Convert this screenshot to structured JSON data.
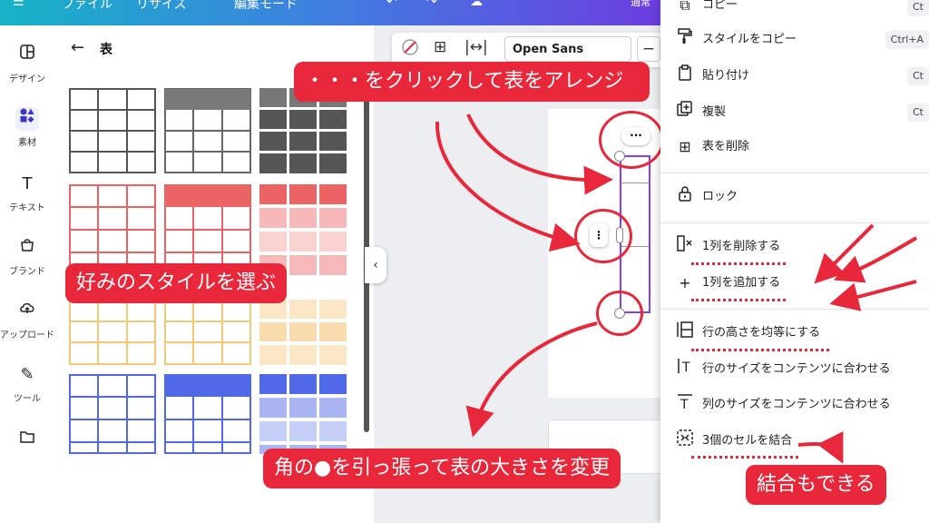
{
  "topbar": {
    "file_label": "ファイル",
    "resize_label": "リサイズ",
    "edit_label": "編集モード",
    "right_label": "通常"
  },
  "sidebar": {
    "items": [
      {
        "label": "デザイン",
        "icon": "layout-icon"
      },
      {
        "label": "素材",
        "icon": "elements-icon"
      },
      {
        "label": "テキスト",
        "icon": "text-icon"
      },
      {
        "label": "ブランド",
        "icon": "brand-icon"
      },
      {
        "label": "アップロード",
        "icon": "upload-icon"
      },
      {
        "label": "ツール",
        "icon": "tools-icon"
      },
      {
        "label": "",
        "icon": "folder-icon"
      }
    ]
  },
  "panel": {
    "title": "表",
    "styles": [
      {
        "name": "gray",
        "header": "#7a7a7a",
        "border": "#555555",
        "fill": "#ffffff",
        "alt": "#555555"
      },
      {
        "name": "red",
        "header": "#ec6363",
        "border": "#ec6363",
        "fill": "#fbd2d2",
        "alt": "#f6b8b8"
      },
      {
        "name": "orange",
        "header": "#f5c776",
        "border": "#f5c776",
        "fill": "#fbe7c6",
        "alt": "#f8dcae"
      },
      {
        "name": "blue",
        "header": "#4f69e8",
        "border": "#4f69e8",
        "fill": "#c6cff8",
        "alt": "#aab6f3"
      }
    ]
  },
  "toolbar": {
    "font_name": "Open Sans"
  },
  "context_menu": {
    "items": [
      {
        "label": "コピー",
        "icon": "copy-icon",
        "shortcut": "Ct"
      },
      {
        "label": "スタイルをコピー",
        "icon": "paint-roller-icon",
        "shortcut": "Ctrl+A"
      },
      {
        "label": "貼り付け",
        "icon": "paste-icon",
        "shortcut": "Ct"
      },
      {
        "label": "複製",
        "icon": "duplicate-icon",
        "shortcut": "Ct"
      },
      {
        "label": "表を削除",
        "icon": "table-delete-icon",
        "shortcut": ""
      },
      {
        "label": "ロック",
        "icon": "lock-icon",
        "shortcut": ""
      },
      {
        "label": "1列を削除する",
        "icon": "column-delete-icon",
        "shortcut": ""
      },
      {
        "label": "1列を追加する",
        "icon": "plus-icon",
        "shortcut": ""
      },
      {
        "label": "行の高さを均等にする",
        "icon": "row-height-icon",
        "shortcut": ""
      },
      {
        "label": "行のサイズをコンテンツに合わせる",
        "icon": "row-fit-icon",
        "shortcut": ""
      },
      {
        "label": "列のサイズをコンテンツに合わせる",
        "icon": "column-fit-icon",
        "shortcut": ""
      },
      {
        "label": "3個のセルを結合",
        "icon": "merge-cells-icon",
        "shortcut": ""
      }
    ]
  },
  "annotations": {
    "arrange": "・・・をクリックして表をアレンジ",
    "choose_style": "好みのスタイルを選ぶ",
    "resize": "角の●を引っ張って表の大きさを変更",
    "merge": "結合もできる"
  },
  "colors": {
    "accent": "#e8283a",
    "selection": "#8b3df0"
  }
}
